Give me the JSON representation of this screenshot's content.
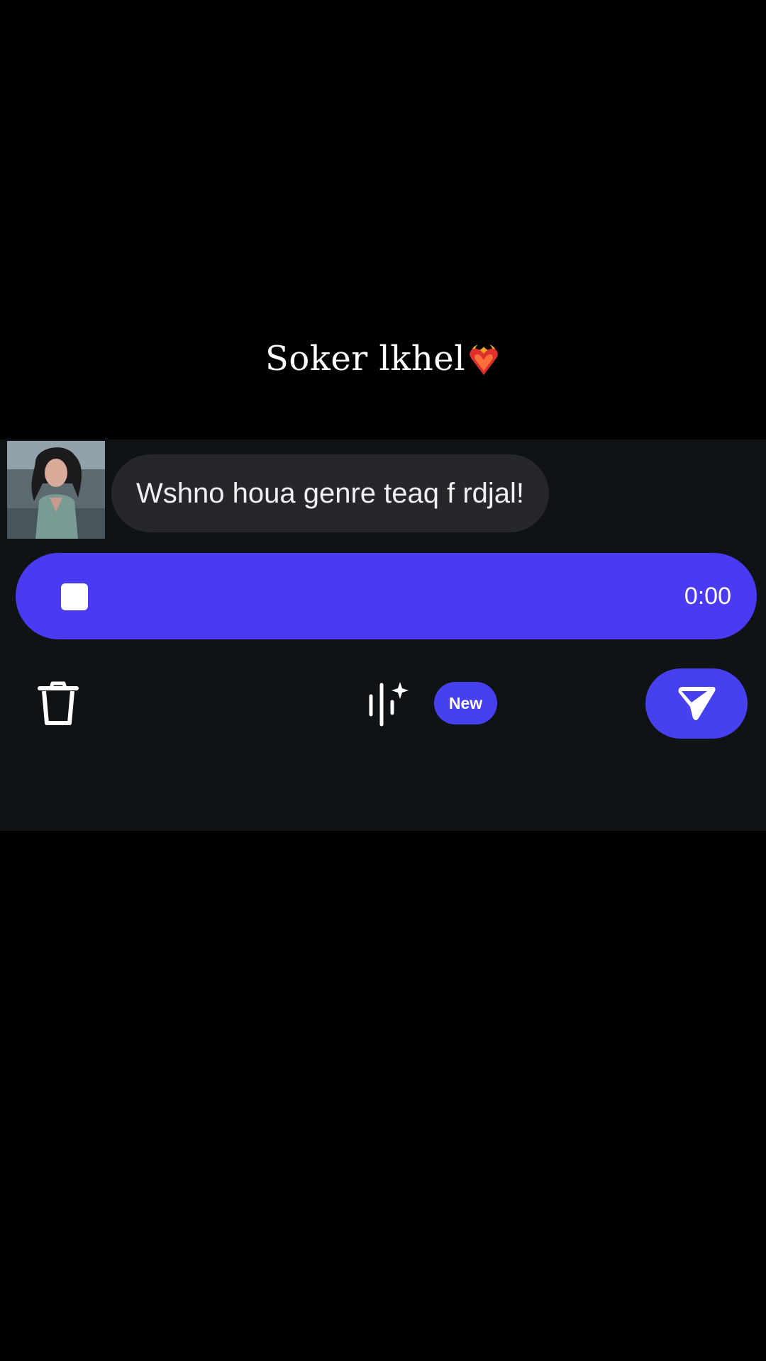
{
  "caption": {
    "text": "Soker lkhel",
    "emoji_icon": "heart-on-fire-icon"
  },
  "chat": {
    "avatar_icon": "profile-photo",
    "message": "Wshno houa genre teaq f rdjal!"
  },
  "recorder": {
    "stop_icon": "stop-icon",
    "timer": "0:00",
    "color": "#4a3af2"
  },
  "toolbar": {
    "delete_icon": "trash-icon",
    "voice_effects_icon": "voice-effects-sparkle-icon",
    "new_badge": "New",
    "send_icon": "send-icon",
    "accent": "#4640ee"
  },
  "colors": {
    "background": "#000000",
    "panel": "#101316",
    "bubble": "#25272b"
  }
}
